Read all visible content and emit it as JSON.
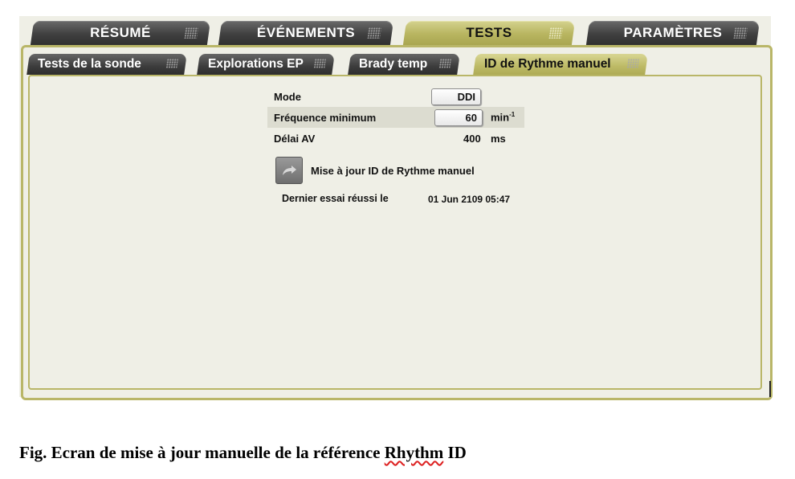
{
  "main_tabs": [
    {
      "label": "RÉSUMÉ",
      "active": false
    },
    {
      "label": "ÉVÉNEMENTS",
      "active": false
    },
    {
      "label": "TESTS",
      "active": true
    },
    {
      "label": "PARAMÈTRES",
      "active": false
    }
  ],
  "sub_tabs": [
    {
      "label": "Tests de la sonde",
      "active": false
    },
    {
      "label": "Explorations EP",
      "active": false
    },
    {
      "label": "Brady temp",
      "active": false
    },
    {
      "label": "ID de Rythme manuel",
      "active": true
    }
  ],
  "params": {
    "mode": {
      "label": "Mode",
      "value": "DDI"
    },
    "freq": {
      "label": "Fréquence minimum",
      "value": "60",
      "unit": "min",
      "unit_sup": "-1"
    },
    "av": {
      "label": "Délai AV",
      "value": "400",
      "unit": "ms"
    }
  },
  "update": {
    "label": "Mise à jour ID de Rythme manuel",
    "icon": "arrow-icon"
  },
  "last_test": {
    "label": "Dernier essai réussi le",
    "value": "01 Jun 2109 05:47"
  },
  "caption": {
    "prefix": "Fig. Ecran de mise à jour manuelle de la référence ",
    "underlined": "Rhythm",
    "suffix": " ID"
  },
  "colors": {
    "active_tab": "#b8b560",
    "inactive_tab": "#404040",
    "frame": "#b9b668",
    "background": "#efefe6"
  }
}
